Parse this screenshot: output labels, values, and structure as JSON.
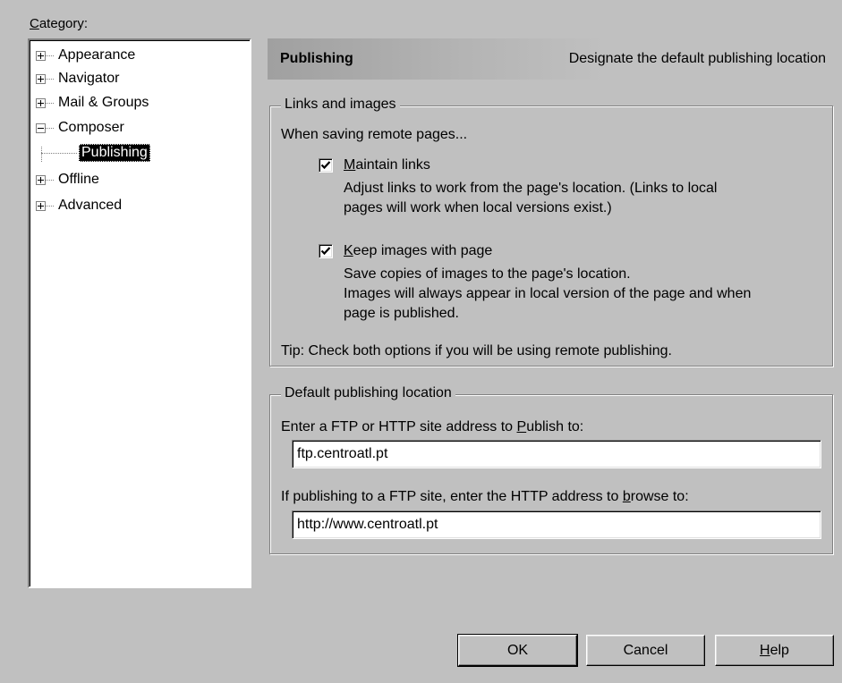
{
  "category": {
    "label_prefix": "C",
    "label_rest": "ategory:"
  },
  "tree": {
    "items": [
      {
        "label": "Appearance",
        "expander": "plus"
      },
      {
        "label": "Navigator",
        "expander": "plus"
      },
      {
        "label": "Mail & Groups",
        "expander": "plus"
      },
      {
        "label": "Composer",
        "expander": "minus"
      },
      {
        "label": "Publishing",
        "selected": true
      },
      {
        "label": "Offline",
        "expander": "plus"
      },
      {
        "label": "Advanced",
        "expander": "plus"
      }
    ]
  },
  "header": {
    "title": "Publishing",
    "description": "Designate the default publishing location"
  },
  "links_group": {
    "title": "Links and images",
    "intro": "When saving remote pages...",
    "maintain_links": {
      "label_prefix": "M",
      "label_rest": "aintain links",
      "checked": true,
      "desc_line1": "Adjust links to work from the page's location. (Links to local",
      "desc_line2": "pages will work when local versions exist.)"
    },
    "keep_images": {
      "label_prefix": "K",
      "label_rest": "eep images with page",
      "checked": true,
      "desc_line1": "Save copies of images to the page's location.",
      "desc_line2": "Images will always appear in local version of the page and when",
      "desc_line3": "page is published."
    },
    "tip": "Tip: Check both options if you will be using remote publishing."
  },
  "location_group": {
    "title": "Default publishing location",
    "publish_label_a": "Enter a FTP or HTTP site address to ",
    "publish_label_u": "P",
    "publish_label_b": "ublish to:",
    "publish_value": "ftp.centroatl.pt",
    "browse_label_a": "If publishing to a FTP site, enter the HTTP address to ",
    "browse_label_u": "b",
    "browse_label_b": "rowse to:",
    "browse_value": "http://www.centroatl.pt"
  },
  "buttons": {
    "ok": "OK",
    "cancel": "Cancel",
    "help_prefix": "H",
    "help_rest": "elp"
  },
  "colors": {
    "dialog_bg": "#c0c0c0",
    "selection_bg": "#000000",
    "header_gradient_start": "#a0a0a0"
  }
}
